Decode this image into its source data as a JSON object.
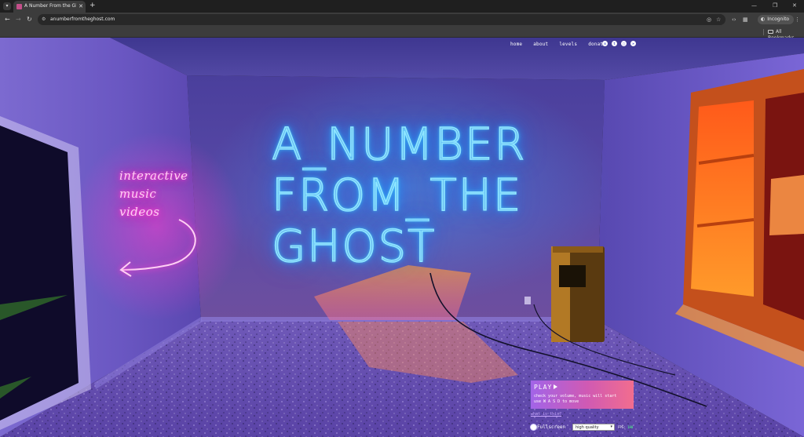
{
  "browser": {
    "tab_title": "A Number From the Ghost | Int",
    "url": "anumberfromtheghost.com",
    "incognito_label": "Incognito",
    "bookmarks_label": "All Bookmarks",
    "icons": {
      "tab_list": "chevron-down-icon",
      "close": "close-icon",
      "new_tab": "plus-icon",
      "back": "back-arrow-icon",
      "forward": "forward-arrow-icon",
      "reload": "reload-icon",
      "site_info": "site-info-icon",
      "eye_off": "tracking-protection-icon",
      "star": "bookmark-star-icon",
      "extensions": "extensions-icon",
      "menu": "kebab-menu-icon"
    }
  },
  "site": {
    "nav": [
      {
        "label": "home"
      },
      {
        "label": "about"
      },
      {
        "label": "levels"
      },
      {
        "label": "donate"
      }
    ],
    "socials": [
      "spotify-icon",
      "twitter-icon",
      "instagram-icon",
      "telegram-icon"
    ],
    "neon_title": [
      "A_NUMBER",
      "FROM_THE",
      "GHOST"
    ],
    "pink_sign": [
      "interactive",
      "music",
      "videos"
    ],
    "play": {
      "label": "PLAY",
      "hint_line1": "check your volume, music will start",
      "hint_line2": "use W A S D to move"
    },
    "what_link": "what is this?",
    "fullscreen_label": "Fullscreen",
    "quality_value": "high quality",
    "fps_label": "FPS:",
    "fps_value": "100"
  },
  "colors": {
    "neon_blue": "#8fe6ff",
    "neon_pink": "#ff4fd8",
    "wall": "#5b4fb0",
    "window_orange": "#ff8a1e",
    "play_gradient_start": "#a264e8",
    "play_gradient_end": "#f26d8e"
  }
}
